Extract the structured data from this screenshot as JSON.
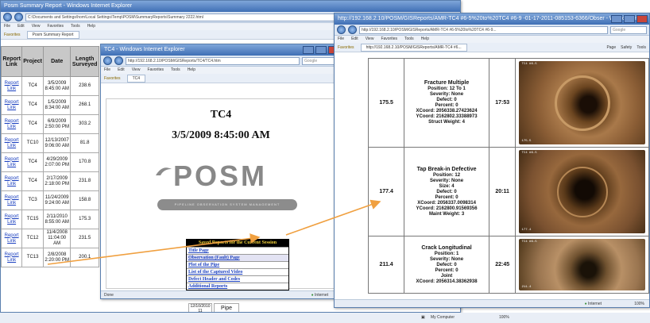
{
  "win1": {
    "title": "Posm Summary Report - Windows Internet Explorer",
    "address": "C:\\Documents and Settings\\hom\\Local Settings\\Temp\\POSM\\SummaryReports\\Summary 2222.html",
    "menu": [
      "File",
      "Edit",
      "View",
      "Favorites",
      "Tools",
      "Help"
    ],
    "favorites_label": "Favorites",
    "tab_label": "Posm Summary Report",
    "columns": [
      "Report Link",
      "Project",
      "Date",
      "Length Surveyed"
    ],
    "rows": [
      {
        "link": "Report Link",
        "project": "TC4",
        "date": "3/5/2009 8:45:00 AM",
        "length": "238.6"
      },
      {
        "link": "Report Link",
        "project": "TC4",
        "date": "1/5/2009 8:34:00 AM",
        "length": "268.1"
      },
      {
        "link": "Report Link",
        "project": "TC4",
        "date": "6/9/2009 2:50:00 PM",
        "length": "303.2"
      },
      {
        "link": "Report Link",
        "project": "TC10",
        "date": "12/13/2007 9:06:00 AM",
        "length": "81.8"
      },
      {
        "link": "Report Link",
        "project": "TC4",
        "date": "4/29/2009 2:07:00 PM",
        "length": "170.8"
      },
      {
        "link": "Report Link",
        "project": "TC4",
        "date": "2/17/2009 2:18:00 PM",
        "length": "231.8"
      },
      {
        "link": "Report Link",
        "project": "TC3",
        "date": "11/24/2009 9:24:00 AM",
        "length": "158.8"
      },
      {
        "link": "Report Link",
        "project": "TC15",
        "date": "2/11/2010 8:55:00 AM",
        "length": "175.3"
      },
      {
        "link": "Report Link",
        "project": "TC12",
        "date": "11/4/2008 11:04:00 AM",
        "length": "231.5"
      },
      {
        "link": "Report Link",
        "project": "TC13",
        "date": "2/8/2008 2:20:00 PM",
        "length": "200.1"
      }
    ],
    "partial_cells": [
      "12/10/2010 11",
      "Pipe"
    ]
  },
  "win2": {
    "title": "TC4 - Windows Internet Explorer",
    "address": "http://192.168.2.10/POSM/GISReports/TC4/TC4.htm",
    "menu": [
      "File",
      "Edit",
      "View",
      "Favorites",
      "Tools",
      "Help"
    ],
    "favorites_label": "Favorites",
    "tab_label": "TC4",
    "project": "TC4",
    "datetime": "3/5/2009 8:45:00 AM",
    "logo_text": "POSM",
    "logo_tagline": "PIPELINE OBSERVATION SYSTEM MANAGEMENT",
    "reports_header": "Saved Reports for the Current Session",
    "reports": [
      "Title Page",
      "Observation (Fault) Page",
      "Plot of the Pipe",
      "List of the Captured Video",
      "Defect Header and Codes",
      "Additional Reports"
    ],
    "status_left": "Done",
    "status_right": "Internet"
  },
  "win3": {
    "title": "http://192.168.2.10/POSM/GISReports/AMR-TC4 #6-5%20to%20TC4 #6-9 -01-17-2011-085153-6366/Obser - Windows Inte...",
    "address": "http://192.168.2.10/POSM/GISReports/AMR-TC4 #6-5%20to%20TC4 #6-9...",
    "menu": [
      "File",
      "Edit",
      "View",
      "Favorites",
      "Tools",
      "Help"
    ],
    "favorites_label": "Favorites",
    "tab_label": "http://192.168.2.10/POSM/GISReports/AMR-TC4 #6...",
    "toolbar": [
      "Page",
      "Safety",
      "Tools"
    ],
    "observations": [
      {
        "distance": "175.5",
        "type": "Fracture Multiple",
        "lines": [
          "Position: 12 To 1",
          "Severity: None",
          "Defect: 0",
          "Percent: 0",
          "XCoord: 2056338.27423624",
          "YCoord: 2162802.33388973",
          "Struct Weight: 4"
        ],
        "time": "17:53",
        "osd_top": "TC4 #6-5",
        "osd_bottom": "175.5"
      },
      {
        "distance": "177.4",
        "type": "Tap Break-in Defective",
        "lines": [
          "Position: 12",
          "Severity: None",
          "Size: 4",
          "Defect: 0",
          "Percent: 0",
          "XCoord: 2056337.0098314",
          "YCoord: 2162800.91569356",
          "Maint Weight: 3"
        ],
        "time": "20:11",
        "osd_top": "TC4 #6-5",
        "osd_bottom": "177.4"
      },
      {
        "distance": "211.4",
        "type": "Crack Longitudinal",
        "lines": [
          "Position: 1",
          "Severity: None",
          "Defect: 0",
          "Percent: 0",
          "Joint",
          "XCoord: 2056314.38362938"
        ],
        "time": "22:45",
        "osd_top": "TC4 #6-5",
        "osd_bottom": "211.4"
      }
    ],
    "status_right": "Internet",
    "zoom": "100%"
  },
  "taskbar": {
    "left": "My Computer",
    "zoom": "100%"
  },
  "colors": {
    "accent": "#f0a040",
    "link": "#1a3fbf",
    "title_gradient_top": "#7fa6d9",
    "title_gradient_bottom": "#3f6fb5"
  }
}
